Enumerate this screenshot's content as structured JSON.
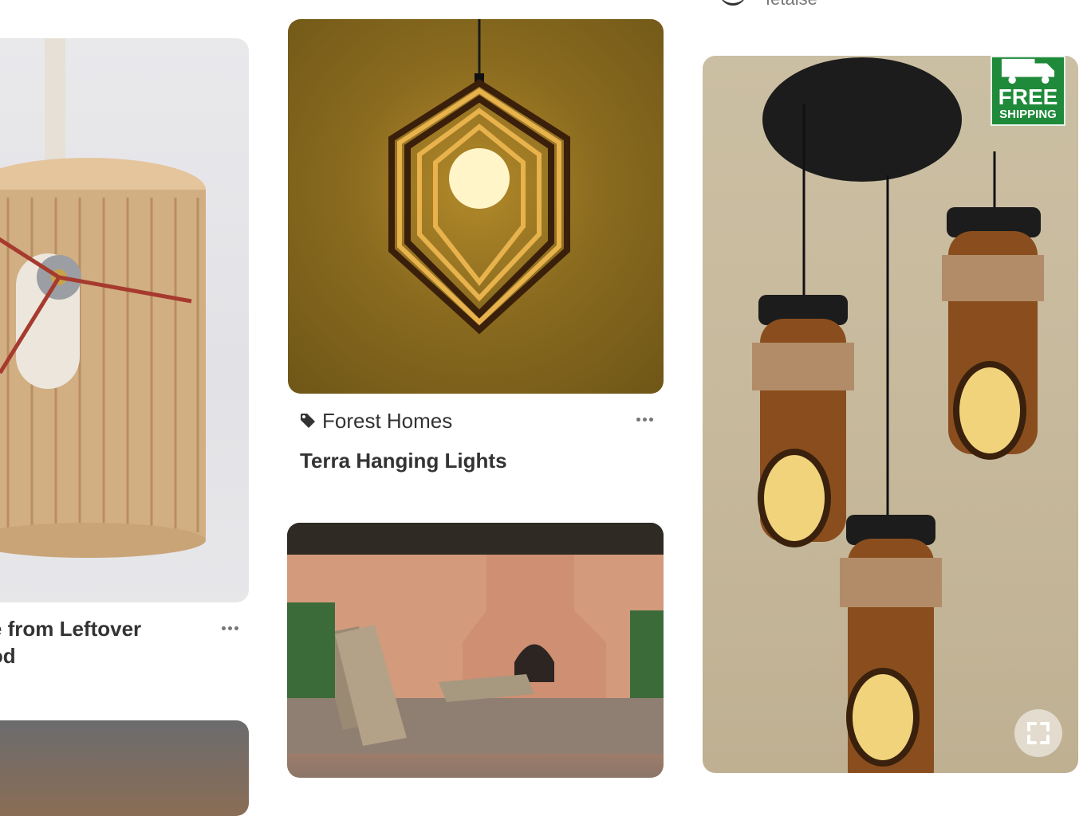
{
  "pins": {
    "left": {
      "title": "de from Leftover\nood",
      "more_label": "More options"
    },
    "middle": {
      "source": "Forest Homes",
      "title": "Terra Hanging Lights",
      "more_label": "More options"
    },
    "right": {
      "top_partial_text": "fetaise",
      "badge_line1": "FREE",
      "badge_line2": "SHIPPING"
    }
  },
  "icons": {
    "tag": "tag-icon",
    "more": "ellipsis-icon",
    "expand": "expand-icon",
    "truck": "truck-icon"
  },
  "colors": {
    "title_text": "#333333",
    "muted_text": "#767676",
    "badge_green": "#1f8a3a"
  }
}
